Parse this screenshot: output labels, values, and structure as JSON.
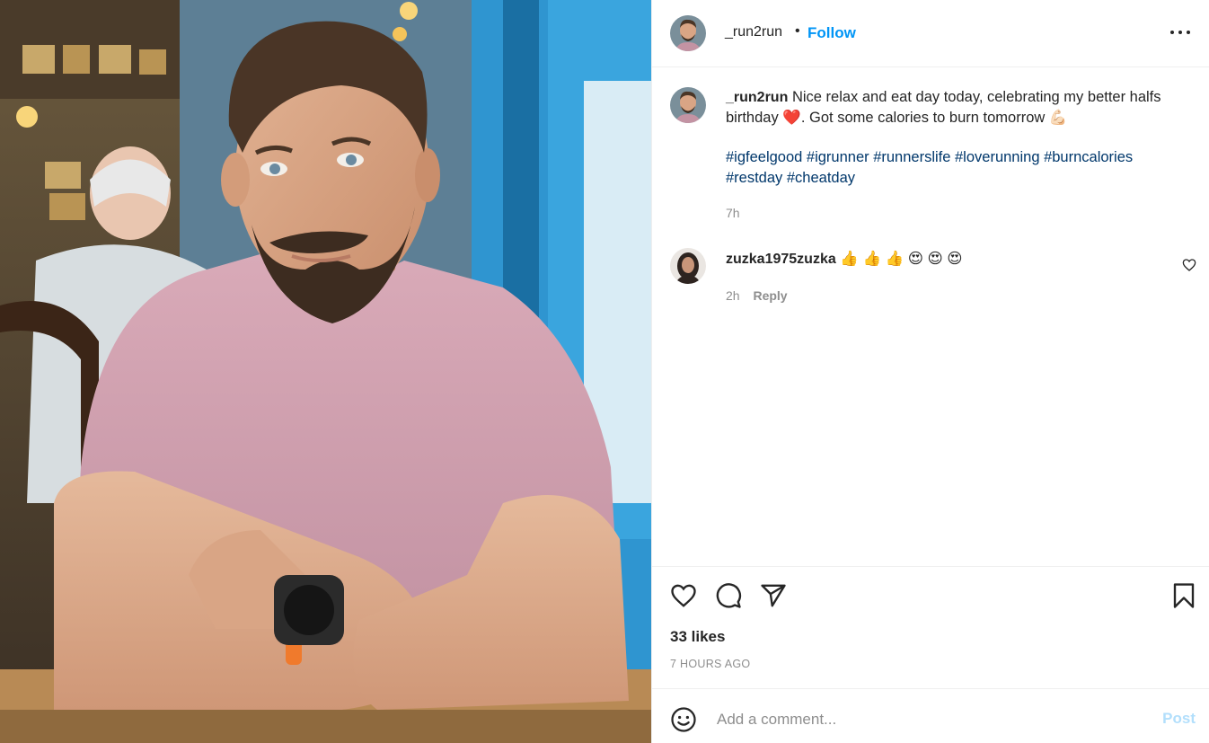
{
  "post": {
    "username": "_run2run",
    "separator": "•",
    "follow_label": "Follow",
    "more_icon": "more-horizontal-icon"
  },
  "caption": {
    "username": "_run2run",
    "text_part1": "Nice relax and eat day today, celebrating my better halfs birthday",
    "heart": "❤️",
    "text_part2": ". Got some calories to burn tomorrow",
    "muscle": "💪🏻",
    "hashtags": "#igfeelgood #igrunner #runnerslife #loverunning #burncalories #restday #cheatday",
    "time": "7h"
  },
  "comments": [
    {
      "username": "zuzka1975zuzka",
      "text": "👍 👍 👍 😍 😍 😍",
      "time": "2h",
      "reply_label": "Reply"
    }
  ],
  "actions": {
    "like_icon": "heart-icon",
    "comment_icon": "comment-icon",
    "share_icon": "send-icon",
    "save_icon": "bookmark-icon"
  },
  "likes": "33 likes",
  "posted_ago": "7 HOURS AGO",
  "add_comment": {
    "placeholder": "Add a comment...",
    "post_label": "Post"
  },
  "colors": {
    "follow": "#0095f6",
    "hashtag": "#00376b",
    "muted": "#8e8e8e",
    "post_disabled": "#b2dffc"
  }
}
